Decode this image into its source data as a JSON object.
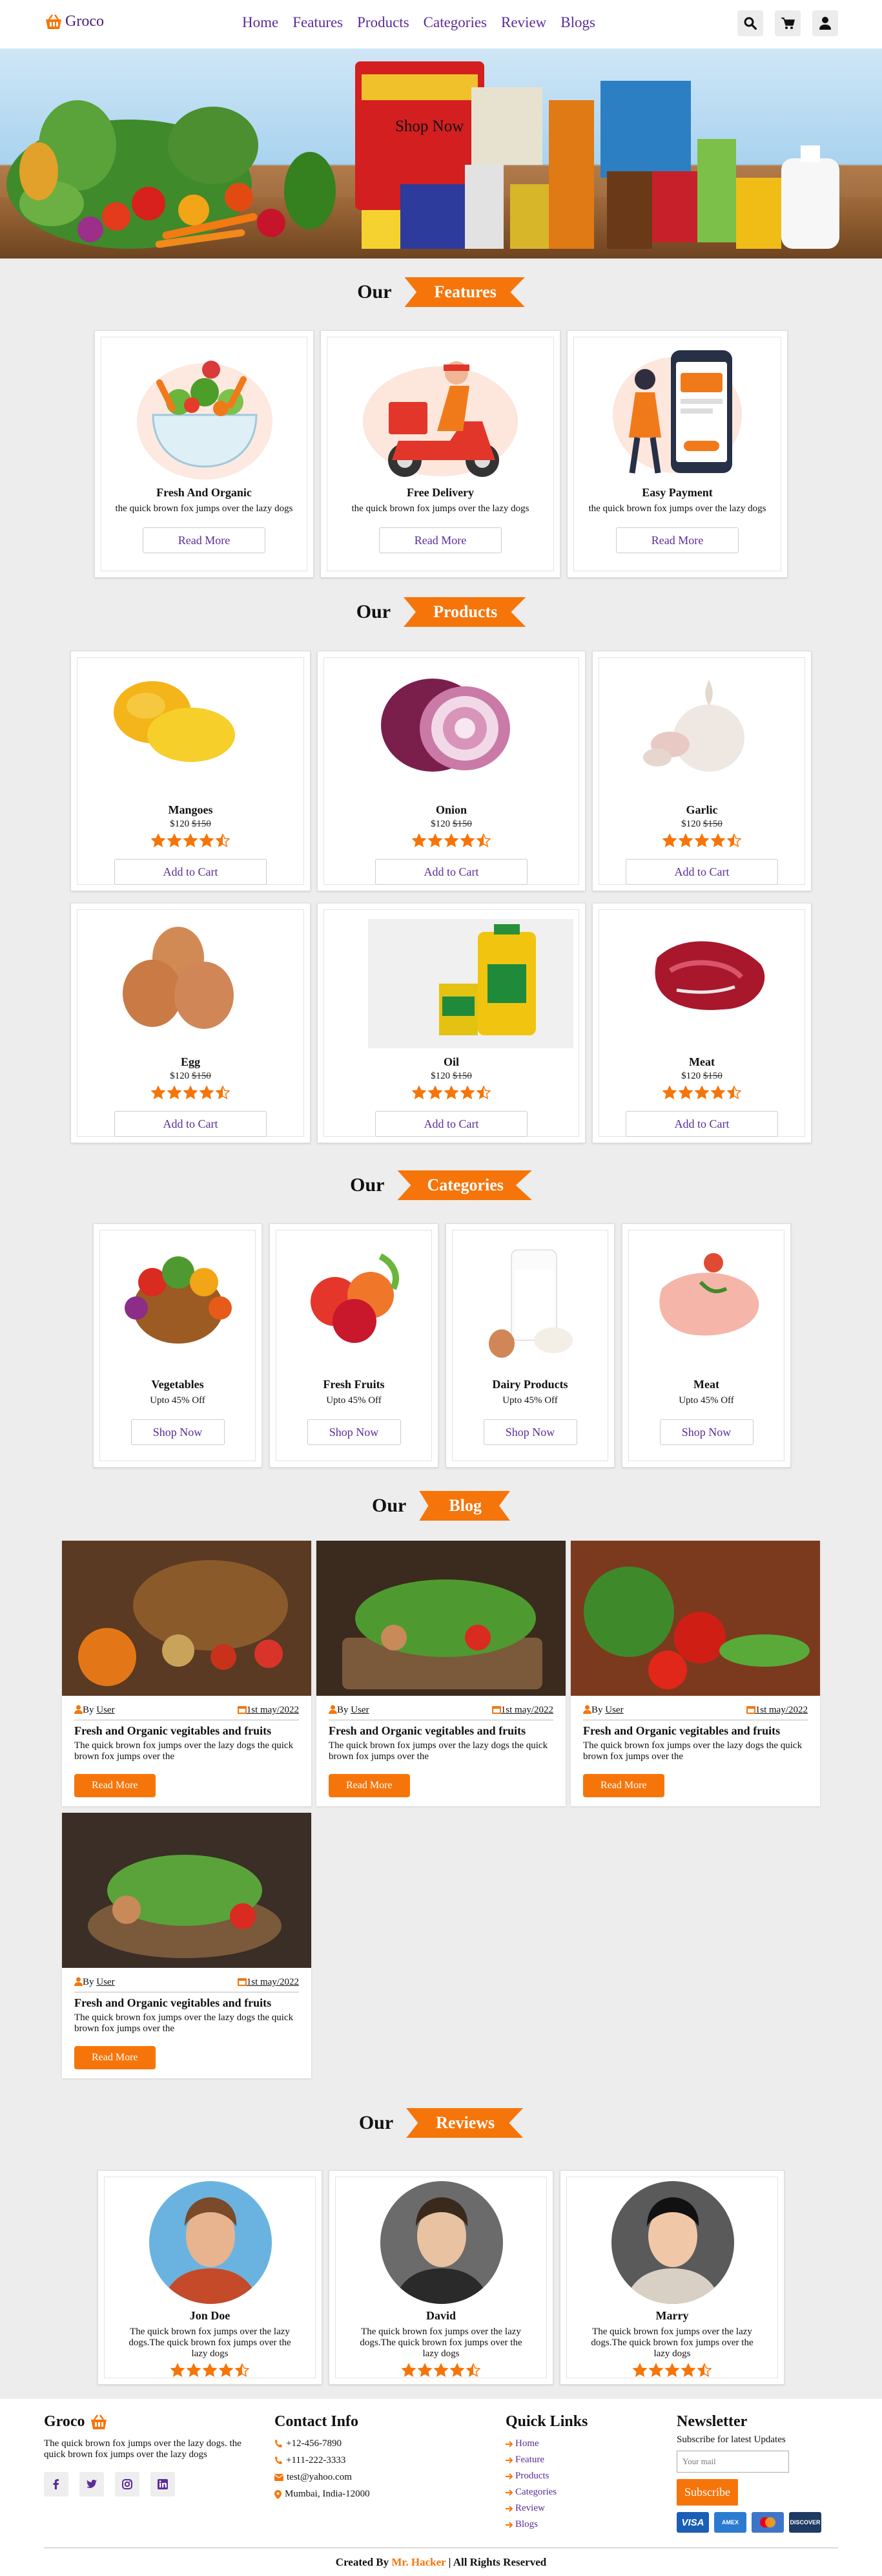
{
  "header": {
    "logo": "Groco",
    "nav": [
      "Home",
      "Features",
      "Products",
      "Categories",
      "Review",
      "Blogs"
    ],
    "icons": [
      "search-icon",
      "cart-icon",
      "user-icon"
    ]
  },
  "hero": {
    "shop_now": "Shop Now"
  },
  "sections": {
    "our": "Our",
    "features": "Features",
    "products": "Products",
    "categories": "Categories",
    "blog": "Blog",
    "reviews": "Reviews"
  },
  "features": [
    {
      "title": "Fresh And Organic",
      "text": "the quick brown fox jumps over the lazy dogs",
      "button": "Read More"
    },
    {
      "title": "Free Delivery",
      "text": "the quick brown fox jumps over the lazy dogs",
      "button": "Read More"
    },
    {
      "title": "Easy Payment",
      "text": "the quick brown fox jumps over the lazy dogs",
      "button": "Read More"
    }
  ],
  "products": [
    {
      "name": "Mangoes",
      "price": "$120",
      "old_price": "$150",
      "rating": 4.5,
      "button": "Add to Cart"
    },
    {
      "name": "Onion",
      "price": "$120",
      "old_price": "$150",
      "rating": 4.5,
      "button": "Add to Cart"
    },
    {
      "name": "Garlic",
      "price": "$120",
      "old_price": "$150",
      "rating": 4.5,
      "button": "Add to Cart"
    },
    {
      "name": "Egg",
      "price": "$120",
      "old_price": "$150",
      "rating": 4.5,
      "button": "Add to Cart"
    },
    {
      "name": "Oil",
      "price": "$120",
      "old_price": "$150",
      "rating": 4.5,
      "button": "Add to Cart"
    },
    {
      "name": "Meat",
      "price": "$120",
      "old_price": "$150",
      "rating": 4.5,
      "button": "Add to Cart"
    }
  ],
  "categories": [
    {
      "name": "Vegetables",
      "offer": "Upto 45% Off",
      "button": "Shop Now"
    },
    {
      "name": "Fresh Fruits",
      "offer": "Upto 45% Off",
      "button": "Shop Now"
    },
    {
      "name": "Dairy Products",
      "offer": "Upto 45% Off",
      "button": "Shop Now"
    },
    {
      "name": "Meat",
      "offer": "Upto 45% Off",
      "button": "Shop Now"
    }
  ],
  "blogs": [
    {
      "by": "By",
      "user": "User",
      "date": "1st may/2022",
      "title": "Fresh and Organic vegitables and fruits",
      "text": "The quick brown fox jumps over the lazy dogs the quick brown fox jumps over the",
      "button": "Read More"
    },
    {
      "by": "By",
      "user": "User",
      "date": "1st may/2022",
      "title": "Fresh and Organic vegitables and fruits",
      "text": "The quick brown fox jumps over the lazy dogs the quick brown fox jumps over the",
      "button": "Read More"
    },
    {
      "by": "By",
      "user": "User",
      "date": "1st may/2022",
      "title": "Fresh and Organic vegitables and fruits",
      "text": "The quick brown fox jumps over the lazy dogs the quick brown fox jumps over the",
      "button": "Read More"
    },
    {
      "by": "By",
      "user": "User",
      "date": "1st may/2022",
      "title": "Fresh and Organic vegitables and fruits",
      "text": "The quick brown fox jumps over the lazy dogs the quick brown fox jumps over the",
      "button": "Read More"
    }
  ],
  "reviews": [
    {
      "name": "Jon Doe",
      "text": "The quick brown fox jumps over the lazy dogs.The quick brown fox jumps over the lazy dogs",
      "rating": 4.5
    },
    {
      "name": "David",
      "text": "The quick brown fox jumps over the lazy dogs.The quick brown fox jumps over the lazy dogs",
      "rating": 4.5
    },
    {
      "name": "Marry",
      "text": "The quick brown fox jumps over the lazy dogs.The quick brown fox jumps over the lazy dogs",
      "rating": 4.5
    }
  ],
  "footer": {
    "brand": "Groco",
    "about": "The quick brown fox jumps over the lazy dogs. the quick brown fox jumps over the lazy dogs",
    "contact_title": "Contact Info",
    "contacts": [
      "+12-456-7890",
      "+111-222-3333",
      "test@yahoo.com",
      "Mumbai, India-12000"
    ],
    "links_title": "Quick Links",
    "links": [
      "Home",
      "Feature",
      "Products",
      "Categories",
      "Review",
      "Blogs"
    ],
    "newsletter_title": "Newsletter",
    "newsletter_text": "Subscribe for latest Updates",
    "email_placeholder": "Your mail",
    "subscribe": "Subscribe",
    "payment_cards": [
      "VISA",
      "AMEX",
      "MasterCard",
      "DISCOVER"
    ],
    "credit_prefix": "Created By",
    "credit_name": "Mr. Hacker",
    "credit_suffix": "| All Rights Reserved"
  },
  "colors": {
    "accent": "#f6750a",
    "brand": "#5b2c99",
    "background": "#ededed"
  }
}
